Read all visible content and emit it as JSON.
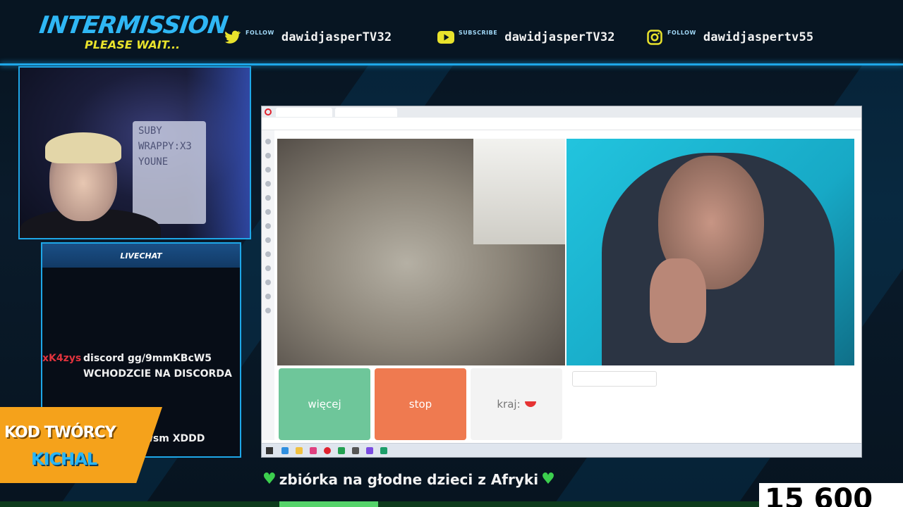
{
  "header": {
    "title": "INTERMISSION",
    "subtitle": "PLEASE WAIT...",
    "socials": [
      {
        "icon": "twitter-icon",
        "label": "FOLLOW",
        "name": "dawidjasperTV32"
      },
      {
        "icon": "youtube-icon",
        "label": "SUBSCRIBE",
        "name": "dawidjasperTV32"
      },
      {
        "icon": "instagram-icon",
        "label": "FOLLOW",
        "name": "dawidjaspertv55"
      }
    ]
  },
  "webcam": {
    "board_lines": [
      "SUBY",
      "WRAPPY:X3",
      "YOUNE"
    ]
  },
  "chat": {
    "header": "LIVECHAT",
    "messages": [
      {
        "user": "xK4zys",
        "text": "discord gg/9mmKBcW5 WCHODZCIE NA DISCORDA"
      }
    ],
    "partial_line": "wsm XDDD"
  },
  "creator_code": {
    "line1": "KOD TWÓRCY",
    "line2": "KICHAL"
  },
  "browser": {
    "buttons": {
      "more": "więcej",
      "stop": "stop",
      "country": "kraj:"
    }
  },
  "ticker": {
    "text": "zbiórka na głodne dzieci z Afryki"
  },
  "counter": {
    "value": "15 600"
  },
  "colors": {
    "accent": "#1ea7e8",
    "title": "#2fb7f5",
    "subtitle": "#e8e22c",
    "more": "#6ec69a",
    "stop": "#ef7a50",
    "heart": "#3ccf4e"
  }
}
